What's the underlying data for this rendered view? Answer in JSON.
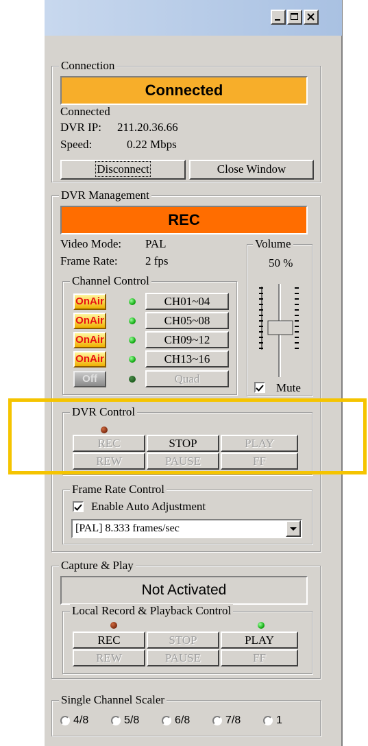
{
  "titlebar": {
    "minimize": "minimize-icon",
    "maximize": "maximize-icon",
    "close": "close-icon"
  },
  "connection": {
    "legend": "Connection",
    "status_banner": "Connected",
    "status_text": "Connected",
    "dvr_ip_label": "DVR IP:",
    "dvr_ip_value": "211.20.36.66",
    "speed_label": "Speed:",
    "speed_value": "0.22 Mbps",
    "disconnect_label": "Disconnect",
    "close_window_label": "Close Window",
    "banner_color": "#f7ae2a"
  },
  "dvr_management": {
    "legend": "DVR Management",
    "status_banner": "REC",
    "banner_color": "#ff6d00",
    "video_mode_label": "Video Mode:",
    "video_mode_value": "PAL",
    "frame_rate_label": "Frame Rate:",
    "frame_rate_value": "2 fps",
    "channel_control": {
      "legend": "Channel Control",
      "rows": [
        {
          "onair": "OnAir",
          "channel": "CH01~04"
        },
        {
          "onair": "OnAir",
          "channel": "CH05~08"
        },
        {
          "onair": "OnAir",
          "channel": "CH09~12"
        },
        {
          "onair": "OnAir",
          "channel": "CH13~16"
        },
        {
          "onair": "Off",
          "channel": "Quad"
        }
      ]
    },
    "volume": {
      "legend": "Volume",
      "value": "50 %",
      "level": 0.5,
      "mute_label": "Mute",
      "mute_checked": true
    }
  },
  "dvr_control": {
    "legend": "DVR Control",
    "buttons": [
      "REC",
      "STOP",
      "PLAY",
      "REW",
      "PAUSE",
      "FF"
    ]
  },
  "frame_rate_control": {
    "legend": "Frame Rate Control",
    "auto_adjust_label": "Enable Auto Adjustment",
    "auto_adjust_checked": true,
    "select_value": "[PAL]  8.333 frames/sec"
  },
  "capture_play": {
    "legend": "Capture & Play",
    "status_banner": "Not Activated",
    "local_control": {
      "legend": "Local Record & Playback Control",
      "buttons": [
        "REC",
        "STOP",
        "PLAY",
        "REW",
        "PAUSE",
        "FF"
      ]
    }
  },
  "scaler": {
    "legend": "Single Channel Scaler",
    "options": [
      "4/8",
      "5/8",
      "6/8",
      "7/8",
      "1"
    ]
  }
}
